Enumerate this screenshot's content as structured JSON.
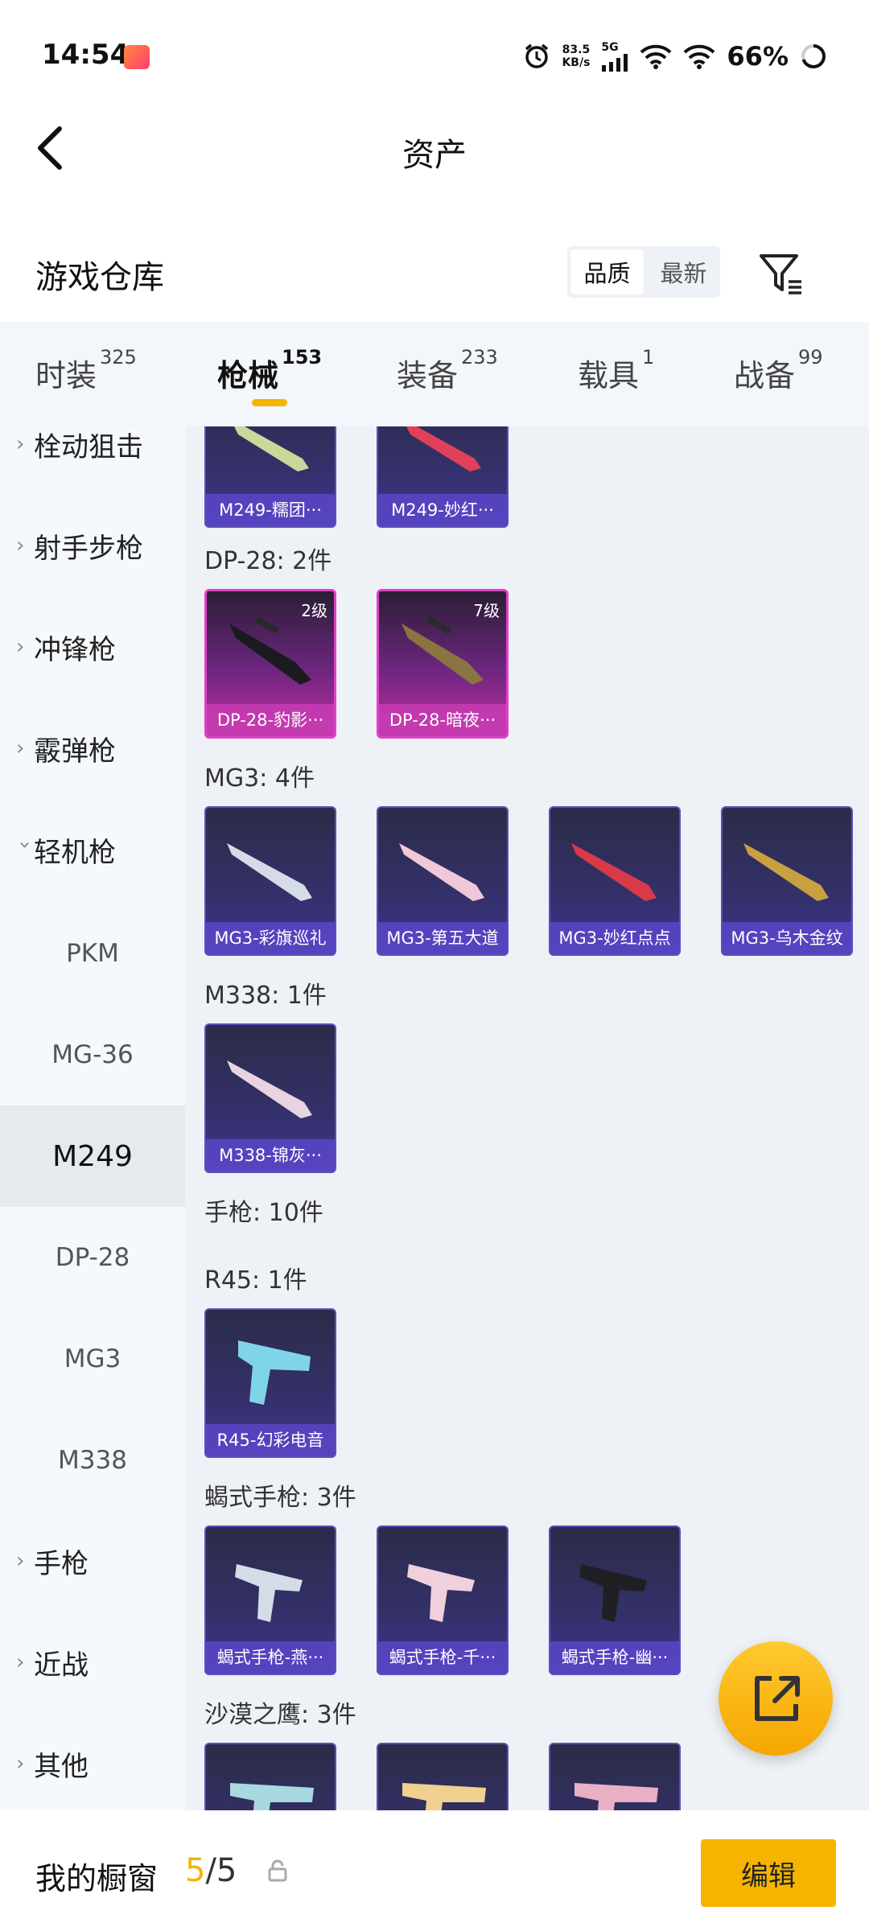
{
  "status": {
    "time": "14:54",
    "speed_top": "83.5",
    "speed_bottom": "KB/s",
    "net": "5G",
    "battery": "66%"
  },
  "header": {
    "title": "资产"
  },
  "warehouse": {
    "label": "游戏仓库",
    "sort_options": [
      "品质",
      "最新"
    ],
    "sort_selected": "品质"
  },
  "tabs": [
    {
      "label": "时装",
      "count": "325"
    },
    {
      "label": "枪械",
      "count": "153",
      "active": true
    },
    {
      "label": "装备",
      "count": "233"
    },
    {
      "label": "载具",
      "count": "1"
    },
    {
      "label": "战备",
      "count": "99"
    }
  ],
  "sidebar": {
    "categories": [
      {
        "label": "栓动狙击",
        "expanded": false
      },
      {
        "label": "射手步枪",
        "expanded": false
      },
      {
        "label": "冲锋枪",
        "expanded": false
      },
      {
        "label": "霰弹枪",
        "expanded": false
      },
      {
        "label": "轻机枪",
        "expanded": true
      }
    ],
    "subitems": [
      "PKM",
      "MG-36",
      "M249",
      "DP-28",
      "MG3",
      "M338"
    ],
    "selected_sub": "M249",
    "after": [
      {
        "label": "手枪"
      },
      {
        "label": "近战"
      },
      {
        "label": "其他"
      }
    ]
  },
  "content": {
    "m249_cards": [
      "M249-糯团···",
      "M249-妙红···"
    ],
    "dp28": {
      "heading": "DP-28: 2件",
      "cards": [
        {
          "name": "DP-28-豹影···",
          "level": "2级"
        },
        {
          "name": "DP-28-暗夜···",
          "level": "7级"
        }
      ]
    },
    "mg3": {
      "heading": "MG3: 4件",
      "cards": [
        "MG3-彩旗巡礼",
        "MG3-第五大道",
        "MG3-妙红点点",
        "MG3-乌木金纹"
      ]
    },
    "m338": {
      "heading": "M338: 1件",
      "cards": [
        "M338-锦灰···"
      ]
    },
    "pistol_heading": "手枪: 10件",
    "r45": {
      "heading": "R45: 1件",
      "cards": [
        "R45-幻彩电音"
      ]
    },
    "scorpion": {
      "heading": "蝎式手枪: 3件",
      "cards": [
        "蝎式手枪-燕···",
        "蝎式手枪-千···",
        "蝎式手枪-幽···"
      ]
    },
    "deagle": {
      "heading": "沙漠之鹰: 3件"
    }
  },
  "bottom": {
    "label": "我的橱窗",
    "count_current": "5",
    "count_sep": "/5",
    "edit_label": "编辑"
  }
}
